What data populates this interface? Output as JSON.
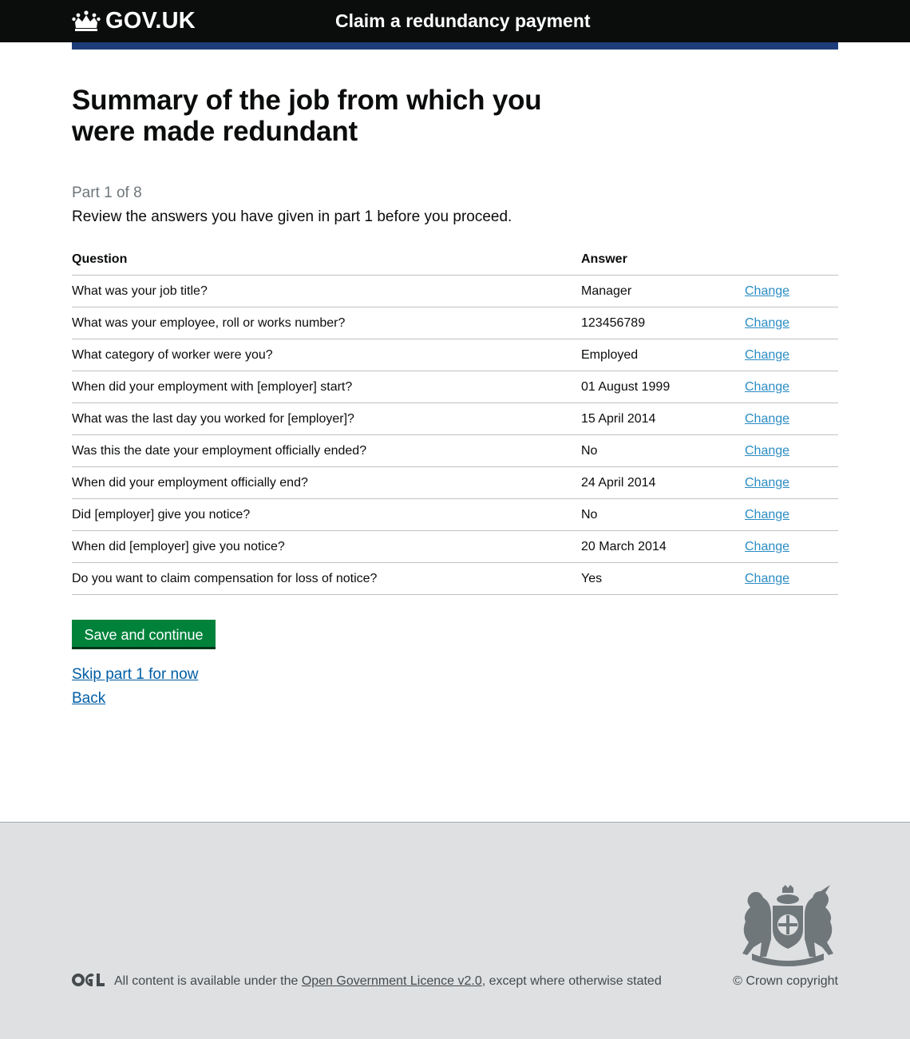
{
  "header": {
    "logo_text": "GOV.UK",
    "service_name": "Claim a redundancy payment"
  },
  "page": {
    "title": "Summary of the job from which you were made redundant",
    "part": "Part 1 of 8",
    "intro": "Review the answers you have given in part 1 before you proceed."
  },
  "table": {
    "headers": {
      "question": "Question",
      "answer": "Answer"
    },
    "change_label": "Change",
    "rows": [
      {
        "question": "What was your job title?",
        "answer": "Manager"
      },
      {
        "question": "What was your employee, roll or works number?",
        "answer": "123456789"
      },
      {
        "question": "What category of worker were you?",
        "answer": "Employed"
      },
      {
        "question": "When did your employment with [employer] start?",
        "answer": "01 August 1999"
      },
      {
        "question": "What was the last day you worked for [employer]?",
        "answer": "15 April 2014"
      },
      {
        "question": "Was this the date your employment officially ended?",
        "answer": "No"
      },
      {
        "question": "When did your employment officially end?",
        "answer": "24 April 2014"
      },
      {
        "question": "Did [employer] give you notice?",
        "answer": "No"
      },
      {
        "question": "When did [employer] give you notice?",
        "answer": "20 March 2014"
      },
      {
        "question": "Do you want to claim compensation for loss of notice?",
        "answer": "Yes"
      }
    ]
  },
  "actions": {
    "save_label": "Save and continue",
    "skip_label": "Skip part 1 for now",
    "back_label": "Back"
  },
  "footer": {
    "licence_prefix": "All content is available under the ",
    "licence_link": "Open Government Licence v2.0",
    "licence_suffix": ", except where otherwise stated",
    "copyright": "© Crown copyright"
  },
  "colors": {
    "header_bg": "#0b0c0c",
    "blue_bar": "#1d3d7a",
    "button_green": "#00823b",
    "link_blue": "#005ea5",
    "footer_bg": "#dee0e2"
  },
  "icons": [
    "crown-icon",
    "ogl-logo-icon",
    "royal-coat-of-arms-icon"
  ]
}
